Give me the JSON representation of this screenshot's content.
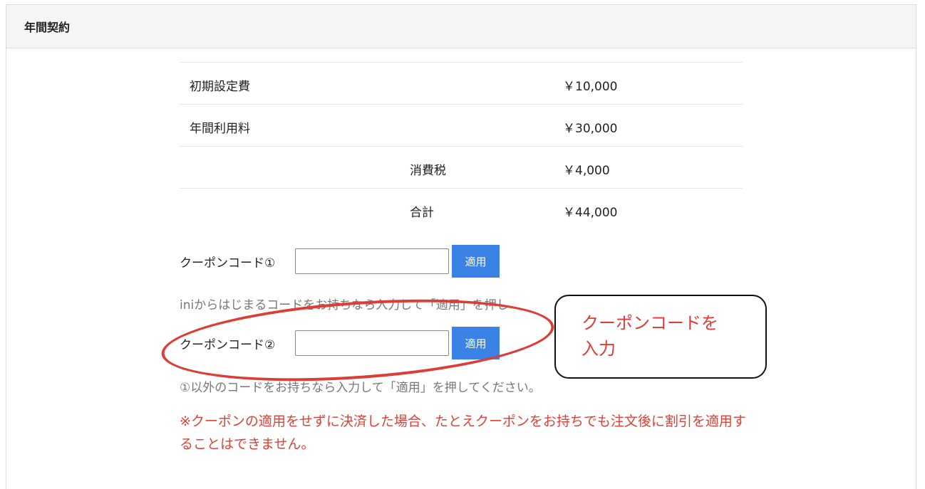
{
  "panel": {
    "title": "年間契約"
  },
  "pricing": {
    "rows": [
      {
        "label": "初期設定費",
        "sublabel": "",
        "value": "￥10,000"
      },
      {
        "label": "年間利用料",
        "sublabel": "",
        "value": "￥30,000"
      },
      {
        "label": "",
        "sublabel": "消費税",
        "value": "￥4,000"
      },
      {
        "label": "",
        "sublabel": "合計",
        "value": "￥44,000"
      }
    ]
  },
  "coupon1": {
    "label": "クーポンコード①",
    "value": "",
    "apply_label": "適用",
    "hint": "iniからはじまるコードをお持ちなら入力して「適用」を押し"
  },
  "coupon2": {
    "label": "クーポンコード②",
    "value": "",
    "apply_label": "適用",
    "hint": "①以外のコードをお持ちなら入力して「適用」を押してください。"
  },
  "warning": "※クーポンの適用をせずに決済した場合、たとえクーポンをお持ちでも注文後に割引を適用することはできません。",
  "annotation": {
    "line1": "クーポンコードを",
    "line2": "入力"
  },
  "colors": {
    "accent": "#3b82e6",
    "warning": "#d9433a",
    "annotation": "#dd3d34"
  }
}
